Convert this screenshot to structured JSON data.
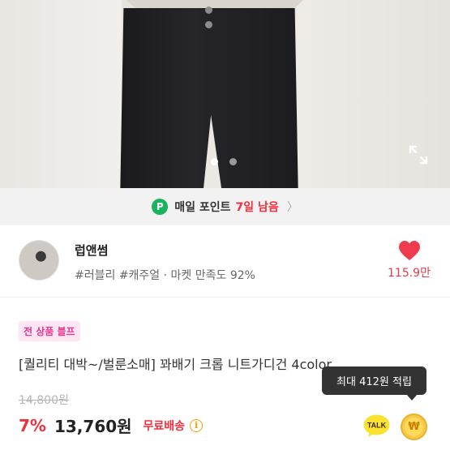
{
  "gallery": {
    "slide_count": 2,
    "active_slide": 1
  },
  "daily_point": {
    "badge": "P",
    "label": "매일 포인트",
    "remaining": "7일 남음",
    "chevron": "〉"
  },
  "shop": {
    "name": "럽앤썸",
    "tags": "#러블리 #캐주얼 · 마켓 만족도 92%",
    "likes": "115.9만",
    "liked": true
  },
  "product": {
    "promo_badge": "전 상품 블프",
    "title": "[퀄리티 대박~/벌룬소매] 꽈배기 크롭 니트가디건 4color",
    "original_price": "14,800원",
    "discount": "7%",
    "price": "13,760원",
    "shipping": "무료배송",
    "info_icon": "i"
  },
  "tooltip": {
    "text": "최대 412원 적립"
  },
  "actions": {
    "talk_label": "TALK",
    "coin_symbol": "₩"
  },
  "colors": {
    "accent_red": "#f0313f",
    "point_green": "#19b35f",
    "promo_pink": "#e8378f",
    "coin_yellow": "#f7c948"
  }
}
